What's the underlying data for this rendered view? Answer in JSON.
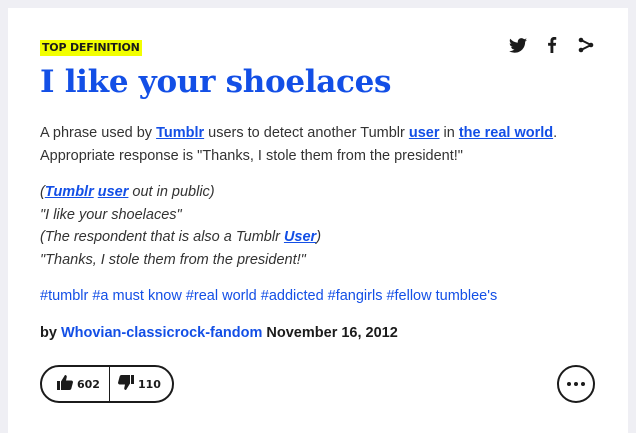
{
  "badge": "TOP DEFINITION",
  "word": "I like your shoelaces",
  "meaning": {
    "t1": "A phrase used by ",
    "l1": "Tumblr",
    "t2": " users to detect another Tumblr ",
    "l2": "user",
    "t3": " in ",
    "l3": "the real world",
    "t4": ".",
    "line2": "Appropriate response is \"Thanks, I stole them from the president!\""
  },
  "example": {
    "open": "(",
    "l1": "Tumblr",
    "sp": " ",
    "l2": "user",
    "rest1": " out in public)",
    "line2": "\"I like your shoelaces\"",
    "line3a": "(The respondent that is also a Tumblr ",
    "l3": "User",
    "line3b": ")",
    "line4": "\"Thanks, I stole them from the president!\""
  },
  "tags": [
    "#tumblr",
    "#a must know",
    "#real world",
    "#addicted",
    "#fangirls",
    "#fellow tumblee's"
  ],
  "contributor": {
    "by": "by ",
    "author": "Whovian-classicrock-fandom",
    "date": " November 16, 2012"
  },
  "votes": {
    "up": "602",
    "down": "110"
  },
  "icons": {
    "share": [
      "twitter-icon",
      "facebook-icon",
      "share-icon"
    ],
    "thumbs": [
      "thumbs-up-icon",
      "thumbs-down-icon"
    ],
    "more": "more-icon"
  },
  "colors": {
    "link": "#134fe6",
    "badge_bg": "#f2ff00",
    "text": "#333333",
    "page_bg": "#efeff4"
  }
}
